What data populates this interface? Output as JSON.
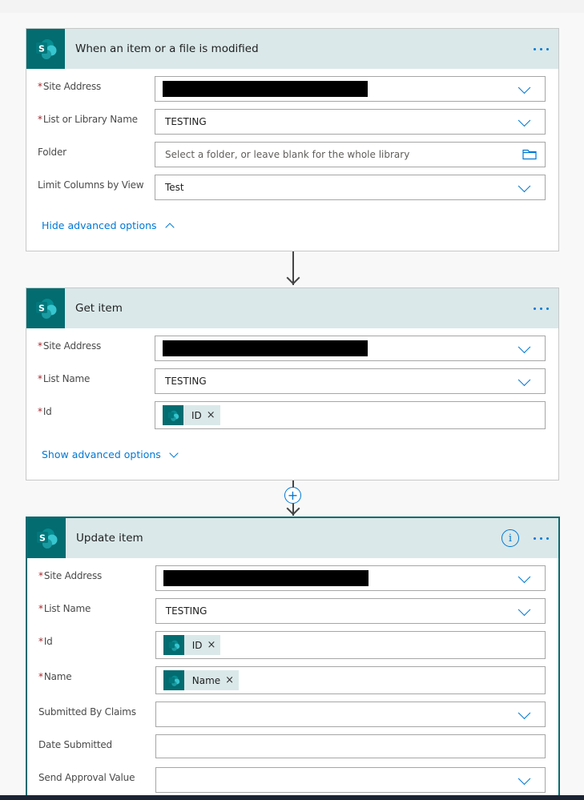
{
  "colors": {
    "accent": "#0078d4",
    "sharepoint": "#036c70",
    "header_bg": "#dae8e9",
    "required": "#a4262c"
  },
  "cards": [
    {
      "title": "When an item or a file is modified",
      "icon": "sharepoint-icon",
      "fields": [
        {
          "label": "Site Address",
          "required": true,
          "value": "",
          "redacted": true,
          "control": "dropdown"
        },
        {
          "label": "List or Library Name",
          "required": true,
          "value": "TESTING",
          "control": "dropdown"
        },
        {
          "label": "Folder",
          "required": false,
          "value": "",
          "placeholder": "Select a folder, or leave blank for the whole library",
          "control": "folder-picker"
        },
        {
          "label": "Limit Columns by View",
          "required": false,
          "value": "Test",
          "control": "dropdown"
        }
      ],
      "advanced_link": "Hide advanced options"
    },
    {
      "title": "Get item",
      "icon": "sharepoint-icon",
      "fields": [
        {
          "label": "Site Address",
          "required": true,
          "value": "",
          "redacted": true,
          "control": "dropdown"
        },
        {
          "label": "List Name",
          "required": true,
          "value": "TESTING",
          "control": "dropdown"
        },
        {
          "label": "Id",
          "required": true,
          "token": "ID",
          "control": "token"
        }
      ],
      "advanced_link": "Show advanced options"
    },
    {
      "title": "Update item",
      "icon": "sharepoint-icon",
      "fields": [
        {
          "label": "Site Address",
          "required": true,
          "value": "",
          "redacted": true,
          "control": "dropdown"
        },
        {
          "label": "List Name",
          "required": true,
          "value": "TESTING",
          "control": "dropdown"
        },
        {
          "label": "Id",
          "required": true,
          "token": "ID",
          "control": "token"
        },
        {
          "label": "Name",
          "required": true,
          "token": "Name",
          "control": "token"
        },
        {
          "label": "Submitted By Claims",
          "required": false,
          "value": "",
          "control": "dropdown"
        },
        {
          "label": "Date Submitted",
          "required": false,
          "value": "",
          "control": "text"
        },
        {
          "label": "Send Approval Value",
          "required": false,
          "value": "",
          "control": "dropdown"
        }
      ]
    }
  ],
  "glyphs": {
    "required_mark": "*",
    "token_remove": "×",
    "info": "i",
    "add": "+",
    "sp_letter": "S"
  }
}
